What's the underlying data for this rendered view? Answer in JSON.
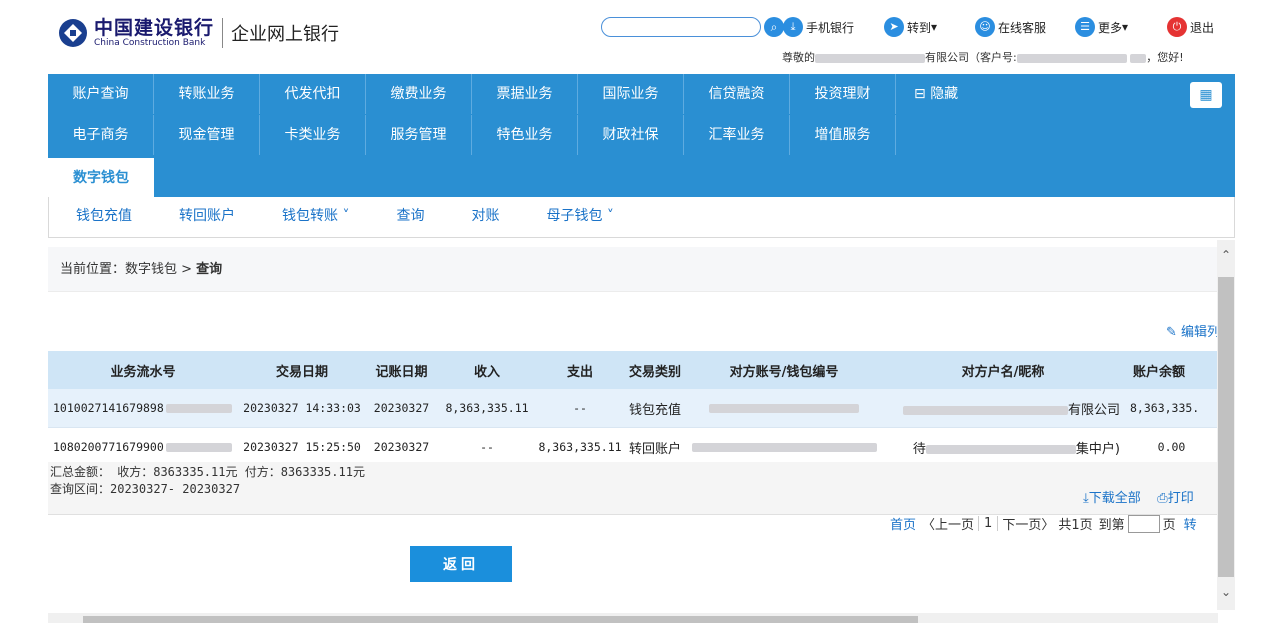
{
  "header": {
    "bank_cn": "中国建设银行",
    "bank_en": "China Construction Bank",
    "ebank_title": "企业网上银行",
    "search_placeholder": "",
    "links": {
      "mobile": "手机银行",
      "goto": "转到",
      "service": "在线客服",
      "more": "更多",
      "logout": "退出"
    },
    "greeting_prefix": "尊敬的",
    "greeting_company_suffix": "有限公司（客户号:",
    "greeting_suffix": "，您好!"
  },
  "nav": {
    "row1": [
      "账户查询",
      "转账业务",
      "代发代扣",
      "缴费业务",
      "票据业务",
      "国际业务",
      "信贷融资",
      "投资理财"
    ],
    "hide_label": "隐藏",
    "row2": [
      "电子商务",
      "现金管理",
      "卡类业务",
      "服务管理",
      "特色业务",
      "财政社保",
      "汇率业务",
      "增值服务"
    ],
    "row3": [
      "数字钱包"
    ]
  },
  "subnav": [
    "钱包充值",
    "转回账户",
    "钱包转账 ˅",
    "查询",
    "对账",
    "母子钱包 ˅"
  ],
  "breadcrumb": {
    "prefix": "当前位置：数字钱包 > ",
    "current": "查询"
  },
  "edit_columns": "编辑列",
  "table": {
    "headers": [
      "业务流水号",
      "交易日期",
      "记账日期",
      "收入",
      "支出",
      "交易类别",
      "对方账号/钱包编号",
      "对方户名/昵称",
      "账户余额"
    ],
    "rows": [
      {
        "serial": "1010027141679898",
        "tx_date": "20230327 14:33:03",
        "post_date": "20230327",
        "income": "8,363,335.11",
        "expense": "--",
        "type": "钱包充值",
        "name_suffix": "有限公司",
        "balance": "8,363,335."
      },
      {
        "serial": "1080200771679900",
        "tx_date": "20230327 15:25:50",
        "post_date": "20230327",
        "income": "--",
        "expense": "8,363,335.11",
        "type": "转回账户",
        "name_prefix": "待",
        "name_suffix": "集中户)",
        "balance": "0.00"
      }
    ]
  },
  "summary": {
    "line1": "汇总金额： 收方：8363335.11元   付方：8363335.11元",
    "line2": "查询区间：20230327- 20230327",
    "download": "下载全部",
    "print": "打印"
  },
  "pager": {
    "first": "首页",
    "prev": "〈上一页",
    "current": "1",
    "next": "下一页〉",
    "total": "共1页",
    "goto": "到第",
    "page_unit": "页",
    "go": "转"
  },
  "back_button": "返回",
  "colors": {
    "nav_bg": "#2a8fd2",
    "link": "#1b73c8",
    "header_row": "#cfe5f6"
  }
}
